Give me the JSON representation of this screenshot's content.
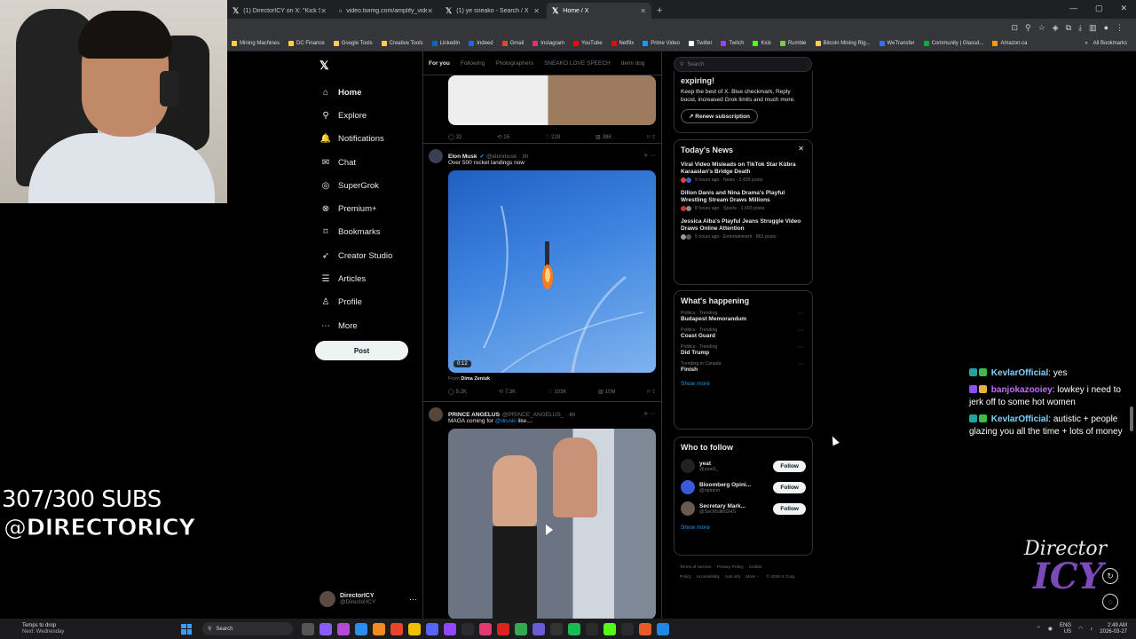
{
  "browser": {
    "tabs": [
      {
        "label": "(1) DirectorICY on X: \"Kick Strea",
        "active": false
      },
      {
        "label": "video.twimg.com/amplify_video",
        "active": false
      },
      {
        "label": "(1) ye sneako - Search / X",
        "active": false
      },
      {
        "label": "Home / X",
        "active": true
      }
    ],
    "bookmarks": [
      "Mining Machines",
      "DC Finance",
      "Google Tools",
      "Creative Tools",
      "LinkedIn",
      "Indeed",
      "Gmail",
      "Instagram",
      "YouTube",
      "Netflix",
      "Prime Video",
      "Twitter",
      "Twitch",
      "Kick",
      "Rumble",
      "Bitcoin Mining Rig...",
      "WeTransfer",
      "Community | Glassd...",
      "Amazon.ca"
    ],
    "all_bookmarks": "All Bookmarks"
  },
  "overlay": {
    "subs": "307/300 SUBS",
    "handle": "@DIRECTORICY",
    "logo_line1": "Director",
    "logo_line2": "ICY"
  },
  "chat": [
    {
      "user": "KevlarOfficial",
      "text": ": yes",
      "color": "#7fd3ff"
    },
    {
      "user": "banjokazooiey",
      "text": ": lowkey i need to jerk off to some hot women",
      "color": "#c36bff"
    },
    {
      "user": "KevlarOfficial",
      "text": ": autistic + people glazing you all the time + lots of money",
      "color": "#7fd3ff"
    }
  ],
  "nav": {
    "items": [
      {
        "label": "Home",
        "icon": "home-icon",
        "glyph": "⌂"
      },
      {
        "label": "Explore",
        "icon": "search-icon",
        "glyph": "⚲"
      },
      {
        "label": "Notifications",
        "icon": "bell-icon",
        "glyph": "🔔"
      },
      {
        "label": "Chat",
        "icon": "mail-icon",
        "glyph": "✉"
      },
      {
        "label": "SuperGrok",
        "icon": "grok-icon",
        "glyph": "◎"
      },
      {
        "label": "Premium+",
        "icon": "premium-icon",
        "glyph": "⊗"
      },
      {
        "label": "Bookmarks",
        "icon": "bookmark-icon",
        "glyph": "⌑"
      },
      {
        "label": "Creator Studio",
        "icon": "rocket-icon",
        "glyph": "➶"
      },
      {
        "label": "Articles",
        "icon": "article-icon",
        "glyph": "☰"
      },
      {
        "label": "Profile",
        "icon": "person-icon",
        "glyph": "♙"
      },
      {
        "label": "More",
        "icon": "more-icon",
        "glyph": "⋯"
      }
    ],
    "post": "Post",
    "account_name": "DirectorICY",
    "account_handle": "@DirectorICY"
  },
  "feed": {
    "tabs": [
      "For you",
      "Following",
      "Photographers",
      "SNEAKO LOVE SPEECH",
      "demi dog"
    ],
    "tweet0_stats": [
      "32",
      "15",
      "228",
      "38K"
    ],
    "tweet1": {
      "name": "Elon Musk",
      "handle": "@elonmusk · 3h",
      "text": "Over 500 rocket landings now",
      "duration": "0:12",
      "from_prefix": "From",
      "from_name": "Dima Zeniuk",
      "stats": [
        "5.2K",
        "7.3K",
        "103K",
        "10M"
      ]
    },
    "tweet2": {
      "name": "PRINCE ANGELUS",
      "handle": "@PRINCE_ANGELUS_ · 4h",
      "text_prefix": "MAGA coming for",
      "mention": "@druski",
      "text_suffix": "like...."
    }
  },
  "sidebar": {
    "search_placeholder": "Search",
    "premium_title": "expiring!",
    "premium_text": "Keep the best of X. Blue checkmark, Reply boost, increased Grok limits and much more.",
    "renew": "Renew subscription",
    "news_title": "Today's News",
    "news": [
      {
        "title": "Viral Video Misleads on TikTok Star Kübra Karaaslan's Bridge Death",
        "meta": "9 hours ago · News · 2,439 posts"
      },
      {
        "title": "Dillon Danis and Nina Drama's Playful Wrestling Stream Draws Millions",
        "meta": "8 hours ago · Sports · 1,603 posts"
      },
      {
        "title": "Jessica Alba's Playful Jeans Struggle Video Draws Online Attention",
        "meta": "5 hours ago · Entertainment · 861 posts"
      }
    ],
    "happening_title": "What's happening",
    "trends": [
      {
        "context": "Politics · Trending",
        "name": "Budapest Memorandum"
      },
      {
        "context": "Politics · Trending",
        "name": "Coast Guard"
      },
      {
        "context": "Politics · Trending",
        "name": "Did Trump"
      },
      {
        "context": "Trending in Canada",
        "name": "Finish"
      }
    ],
    "show_more": "Show more",
    "wtf_title": "Who to follow",
    "follows": [
      {
        "name": "yeat",
        "handle": "@yeat1_",
        "color": "#222"
      },
      {
        "name": "Bloomberg Opini...",
        "handle": "@opinion",
        "color": "#3a5bd9"
      },
      {
        "name": "Secretary Mark...",
        "handle": "@SecMullinDHS",
        "color": "#6b5a50"
      }
    ],
    "follow_label": "Follow",
    "footer": [
      "Terms of Service",
      "Privacy Policy",
      "Cookie Policy",
      "Accessibility",
      "Ads info",
      "More ···",
      "© 2026 X Corp."
    ]
  },
  "taskbar": {
    "weather_line1": "Temps to drop",
    "weather_line2": "Next: Wednesday",
    "search": "Search",
    "lang1": "ENG",
    "lang2": "US",
    "time": "2:49 AM",
    "date": "2026-03-27"
  }
}
